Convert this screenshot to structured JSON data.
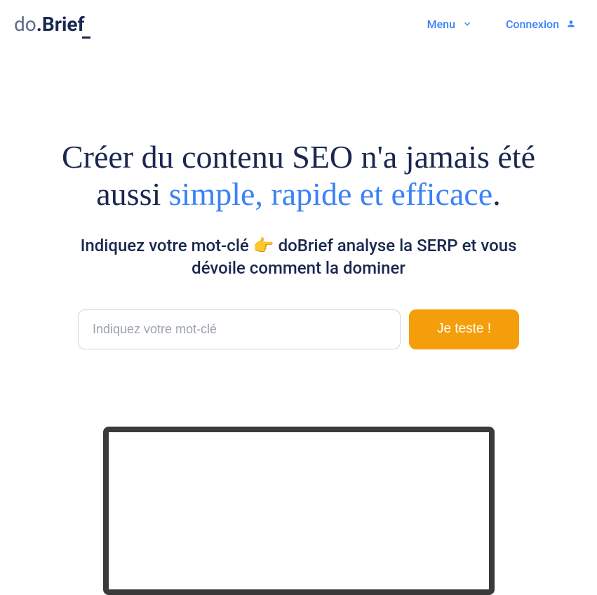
{
  "header": {
    "logo": {
      "prefix": "do",
      "main": ".Brief"
    },
    "nav": {
      "menu_label": "Menu",
      "connexion_label": "Connexion"
    }
  },
  "hero": {
    "title_part1": "Créer du contenu SEO n'a jamais été aussi ",
    "title_highlight": "simple, rapide et efficace",
    "title_part2": ".",
    "subtitle": "Indiquez votre mot-clé 👉 doBrief analyse la SERP et vous dévoile comment la dominer",
    "input_placeholder": "Indiquez votre mot-clé",
    "button_label": "Je teste !"
  }
}
